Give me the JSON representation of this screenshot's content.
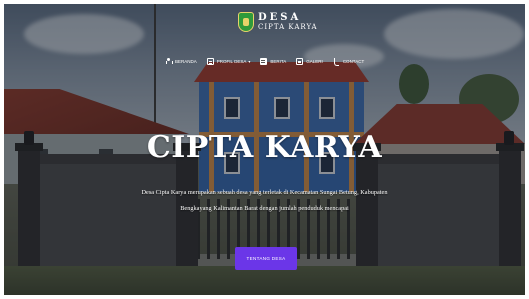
{
  "brand": {
    "line1": "DESA",
    "line2": "CIPTA KARYA",
    "logo_icon": "village-emblem-icon"
  },
  "nav": {
    "items": [
      {
        "label": "BERANDA",
        "icon": "running-person-icon",
        "has_dropdown": false
      },
      {
        "label": "PROFIL DESA",
        "icon": "id-card-icon",
        "has_dropdown": true
      },
      {
        "label": "BERITA",
        "icon": "document-icon",
        "has_dropdown": false
      },
      {
        "label": "GALERI",
        "icon": "image-icon",
        "has_dropdown": false
      },
      {
        "label": "CONTACT",
        "icon": "phone-icon",
        "has_dropdown": false
      }
    ],
    "dropdown_caret": "▾"
  },
  "hero": {
    "title": "CIPTA KARYA",
    "description_line1": "Desa Cipta Karya merupakan sebuah desa yang terletak di Kecamatan Sungai Betung, Kabupaten",
    "description_line2": "Bengkayang Kalimantan Barat dengan jumlah penduduk mencapai",
    "button_label": "TENTANG DESA"
  },
  "colors": {
    "accent_button": "#6b36e8",
    "text": "#ffffff",
    "logo_green": "#2f9a3a",
    "logo_gold": "#e7d36a"
  }
}
